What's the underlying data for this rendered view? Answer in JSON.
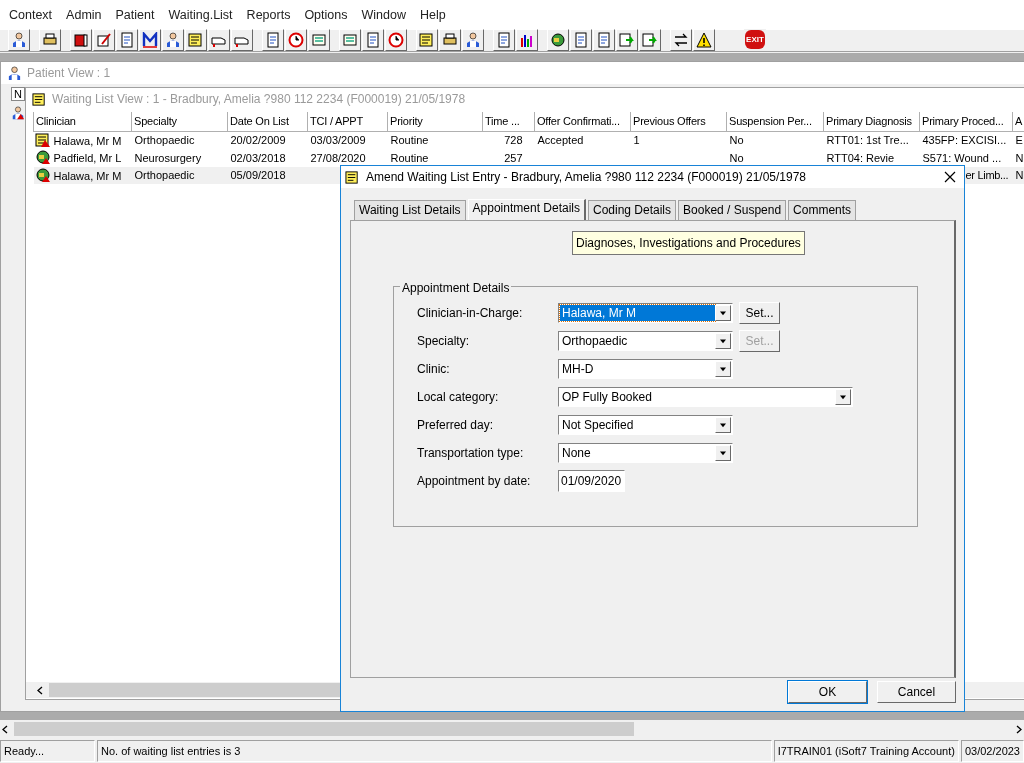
{
  "menu": [
    "Context",
    "Admin",
    "Patient",
    "Waiting.List",
    "Reports",
    "Options",
    "Window",
    "Help"
  ],
  "toolbar": {
    "exit_label": "EXIT"
  },
  "patient_view": {
    "title": "Patient View : 1",
    "column_header": "N"
  },
  "waiting_list_view": {
    "title": "Waiting List View :  1 - Bradbury, Amelia ?980 112 2234 (F000019) 21/05/1978",
    "table": {
      "columns": [
        "Clinician",
        "Specialty",
        "Date On List",
        "TCI / APPT",
        "Priority",
        "Time ...",
        "Offer Confirmati...",
        "Previous Offers",
        "Suspension Per...",
        "Primary Diagnosis",
        "Primary Proced...",
        "A"
      ],
      "rows": [
        {
          "kind": "note",
          "selected": false,
          "cells": [
            "Halawa, Mr M",
            "Orthopaedic",
            "20/02/2009",
            "03/03/2009",
            "Routine",
            "728",
            "Accepted",
            "1",
            "No",
            "RTT01: 1st Tre...",
            "435FP: EXCISI...",
            "E"
          ]
        },
        {
          "kind": "globe",
          "selected": false,
          "cells": [
            "Padfield, Mr L",
            "Neurosurgery",
            "02/03/2018",
            "27/08/2020",
            "Routine",
            "257",
            null,
            null,
            "No",
            "RTT04: Revie",
            "S571: Wound ...",
            "N"
          ]
        },
        {
          "kind": "globe",
          "selected": true,
          "cells": [
            "Halawa, Mr M",
            "Orthopaedic",
            "05/09/2018",
            null,
            null,
            null,
            null,
            null,
            null,
            null,
            "er Limb...",
            "N"
          ]
        }
      ]
    }
  },
  "dialog": {
    "title": "Amend Waiting List Entry - Bradbury, Amelia ?980 112 2234 (F000019) 21/05/1978",
    "tabs": [
      {
        "label": "Waiting List Details",
        "selected": false
      },
      {
        "label": "Appointment Details",
        "selected": true
      },
      {
        "label": "Coding Details",
        "selected": false
      },
      {
        "label": "Booked / Suspend",
        "selected": false
      },
      {
        "label": "Comments",
        "selected": false
      }
    ],
    "tooltip": "Diagnoses, Investigations and Procedures",
    "group_title": "Appointment Details",
    "fields": [
      {
        "label": "Clinician-in-Charge:",
        "kind": "combo",
        "value": "Halawa, Mr M",
        "selected": true,
        "set_button": {
          "label": "Set...",
          "disabled": false
        }
      },
      {
        "label": "Specialty:",
        "kind": "combo",
        "value": "Orthopaedic",
        "selected": false,
        "set_button": {
          "label": "Set...",
          "disabled": true
        }
      },
      {
        "label": "Clinic:",
        "kind": "combo",
        "value": "MH-D",
        "selected": false
      },
      {
        "label": "Local category:",
        "kind": "long-combo",
        "value": "OP Fully Booked",
        "selected": false
      },
      {
        "label": "Preferred day:",
        "kind": "combo",
        "value": "Not Specified",
        "selected": false
      },
      {
        "label": "Transportation type:",
        "kind": "combo",
        "value": "None",
        "selected": false
      },
      {
        "label": "Appointment by date:",
        "kind": "date",
        "value": "01/09/2020",
        "selected": false
      }
    ],
    "buttons": [
      "OK",
      "Cancel"
    ]
  },
  "status_bar": [
    "Ready...",
    "No. of waiting list entries is 3",
    "I7TRAIN01 (iSoft7 Training Account)",
    "03/02/2023"
  ]
}
